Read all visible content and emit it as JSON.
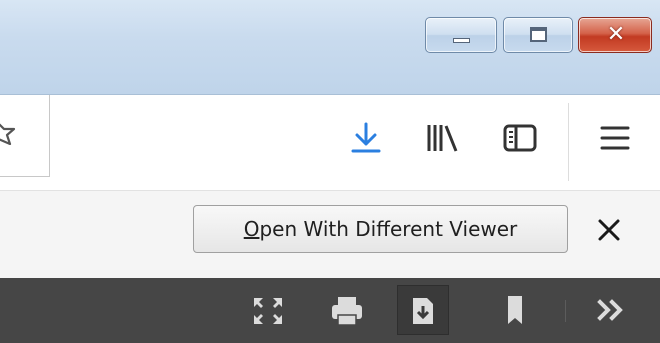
{
  "window": {
    "buttons": {
      "minimize_icon": "minimize-icon",
      "maximize_icon": "maximize-icon",
      "close_icon": "close-icon",
      "close_color": "#c7432a"
    }
  },
  "toolbar": {
    "icons": [
      "star-icon",
      "download-icon",
      "library-icon",
      "sidebar-icon",
      "menu-icon"
    ],
    "accent": "#2b7fe0"
  },
  "infobar": {
    "open_button": {
      "accel": "O",
      "rest": "pen With Different Viewer"
    },
    "close_icon": "close-icon"
  },
  "pdf_toolbar": {
    "icons": [
      "fullscreen-icon",
      "print-icon",
      "download-icon",
      "bookmark-icon",
      "more-tools-icon"
    ],
    "bg": "#464646"
  }
}
